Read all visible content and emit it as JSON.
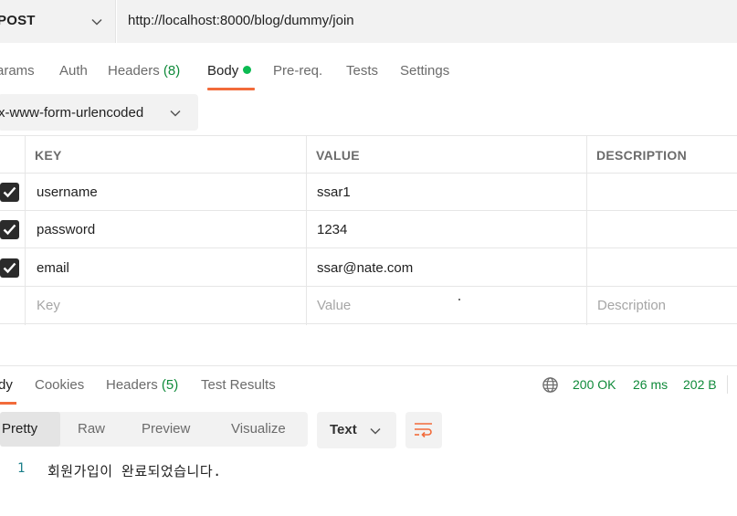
{
  "request": {
    "method": "POST",
    "url": "http://localhost:8000/blog/dummy/join"
  },
  "request_tabs": [
    {
      "label": "arams"
    },
    {
      "label": "Auth"
    },
    {
      "label": "Headers",
      "count": "(8)"
    },
    {
      "label": "Body"
    },
    {
      "label": "Pre-req."
    },
    {
      "label": "Tests"
    },
    {
      "label": "Settings"
    }
  ],
  "body_type": "x-www-form-urlencoded",
  "table": {
    "headers": [
      "KEY",
      "VALUE",
      "DESCRIPTION"
    ],
    "rows": [
      {
        "key": "username",
        "value": "ssar1",
        "description": ""
      },
      {
        "key": "password",
        "value": "1234",
        "description": ""
      },
      {
        "key": "email",
        "value": "ssar@nate.com",
        "description": ""
      }
    ],
    "placeholders": {
      "key": "Key",
      "value": "Value",
      "description": "Description"
    }
  },
  "response_tabs": [
    {
      "label": "dy"
    },
    {
      "label": "Cookies"
    },
    {
      "label": "Headers",
      "count": "(5)"
    },
    {
      "label": "Test Results"
    }
  ],
  "response_status": {
    "status": "200 OK",
    "time": "26 ms",
    "size": "202 B"
  },
  "view_modes": [
    "Pretty",
    "Raw",
    "Preview",
    "Visualize"
  ],
  "format": "Text",
  "response_body": {
    "line_number": "1",
    "text": "회원가입이 완료되었습니다."
  },
  "colors": {
    "accent": "#f26b3a",
    "status_green": "#0f8a3a",
    "body_dot": "#0cbb52"
  }
}
